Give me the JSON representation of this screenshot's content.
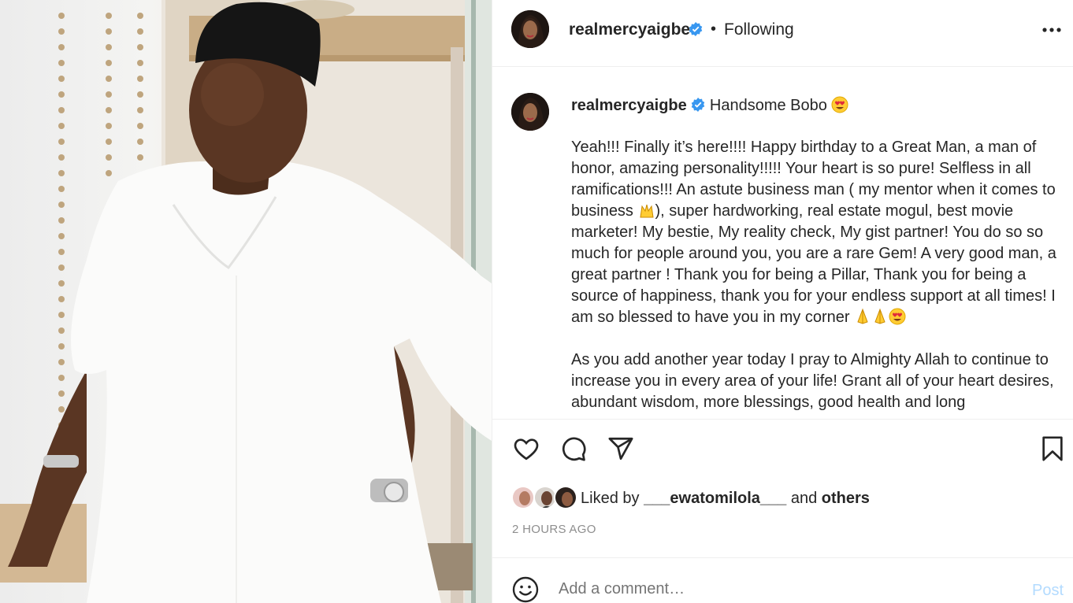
{
  "post": {
    "author": "realmercyaigbe",
    "follow_status": "Following",
    "separator": "•",
    "caption_title": "Handsome Bobo",
    "caption_paragraphs": [
      "Yeah!!! Finally it’s here!!!! Happy birthday to a Great Man, a man of honor, amazing personality!!!!! Your heart is so pure! Selfless in all ramifications!!! An astute business man ( my mentor when it comes to business",
      "As you add another year today I pray to Almighty Allah to continue to increase you in every area of your life! Grant all of your heart desires, abundant wisdom, more blessings, good health and long"
    ],
    "caption_p1_rest": "), super hardworking, real estate mogul, best movie marketer! My bestie, My reality check, My gist partner! You do so so much for people around you, you are a rare Gem! A very good man, a great partner ! Thank you for being a Pillar, Thank you for being a source of happiness, thank you for your endless support at all times! I am so blessed to have you in my corner",
    "liked_by_prefix": "Liked by",
    "liked_by_user": "___ewatomilola___",
    "liked_by_and": "and",
    "liked_by_others": "others",
    "timestamp": "2 HOURS AGO"
  },
  "comment": {
    "placeholder": "Add a comment…",
    "post_label": "Post"
  },
  "icons": {
    "verified": "verified-badge-icon",
    "more": "more-options-icon",
    "like": "heart-icon",
    "comment": "comment-bubble-icon",
    "share": "paper-plane-icon",
    "save": "bookmark-icon",
    "emoji": "smiley-icon"
  },
  "colors": {
    "verified_blue": "#3897f0",
    "post_disabled": "#b3dbff",
    "muted": "#8e8e8e",
    "text": "#262626"
  }
}
